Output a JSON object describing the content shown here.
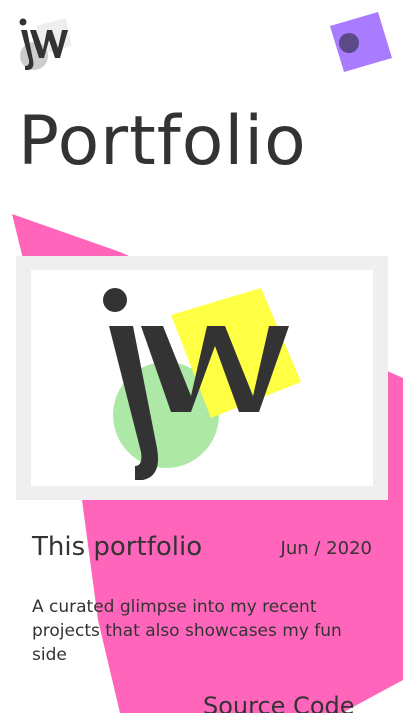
{
  "header": {
    "logo_icon": "jw-logo-icon",
    "menu_icon": "menu-toggle-icon"
  },
  "page": {
    "title": "Portfolio"
  },
  "project": {
    "image_icon": "jw-logo-icon",
    "title": "This portfolio",
    "date": "Jun / 2020",
    "description": "A curated glimpse into my recent projects that also showcases my fun side",
    "source_link": "Source Code"
  },
  "colors": {
    "accent_pink": "#ff66bb",
    "accent_purple": "#a87bff",
    "accent_yellow": "#ffff44",
    "accent_green": "#aee8a6",
    "text": "#333333",
    "frame": "#efefef"
  }
}
